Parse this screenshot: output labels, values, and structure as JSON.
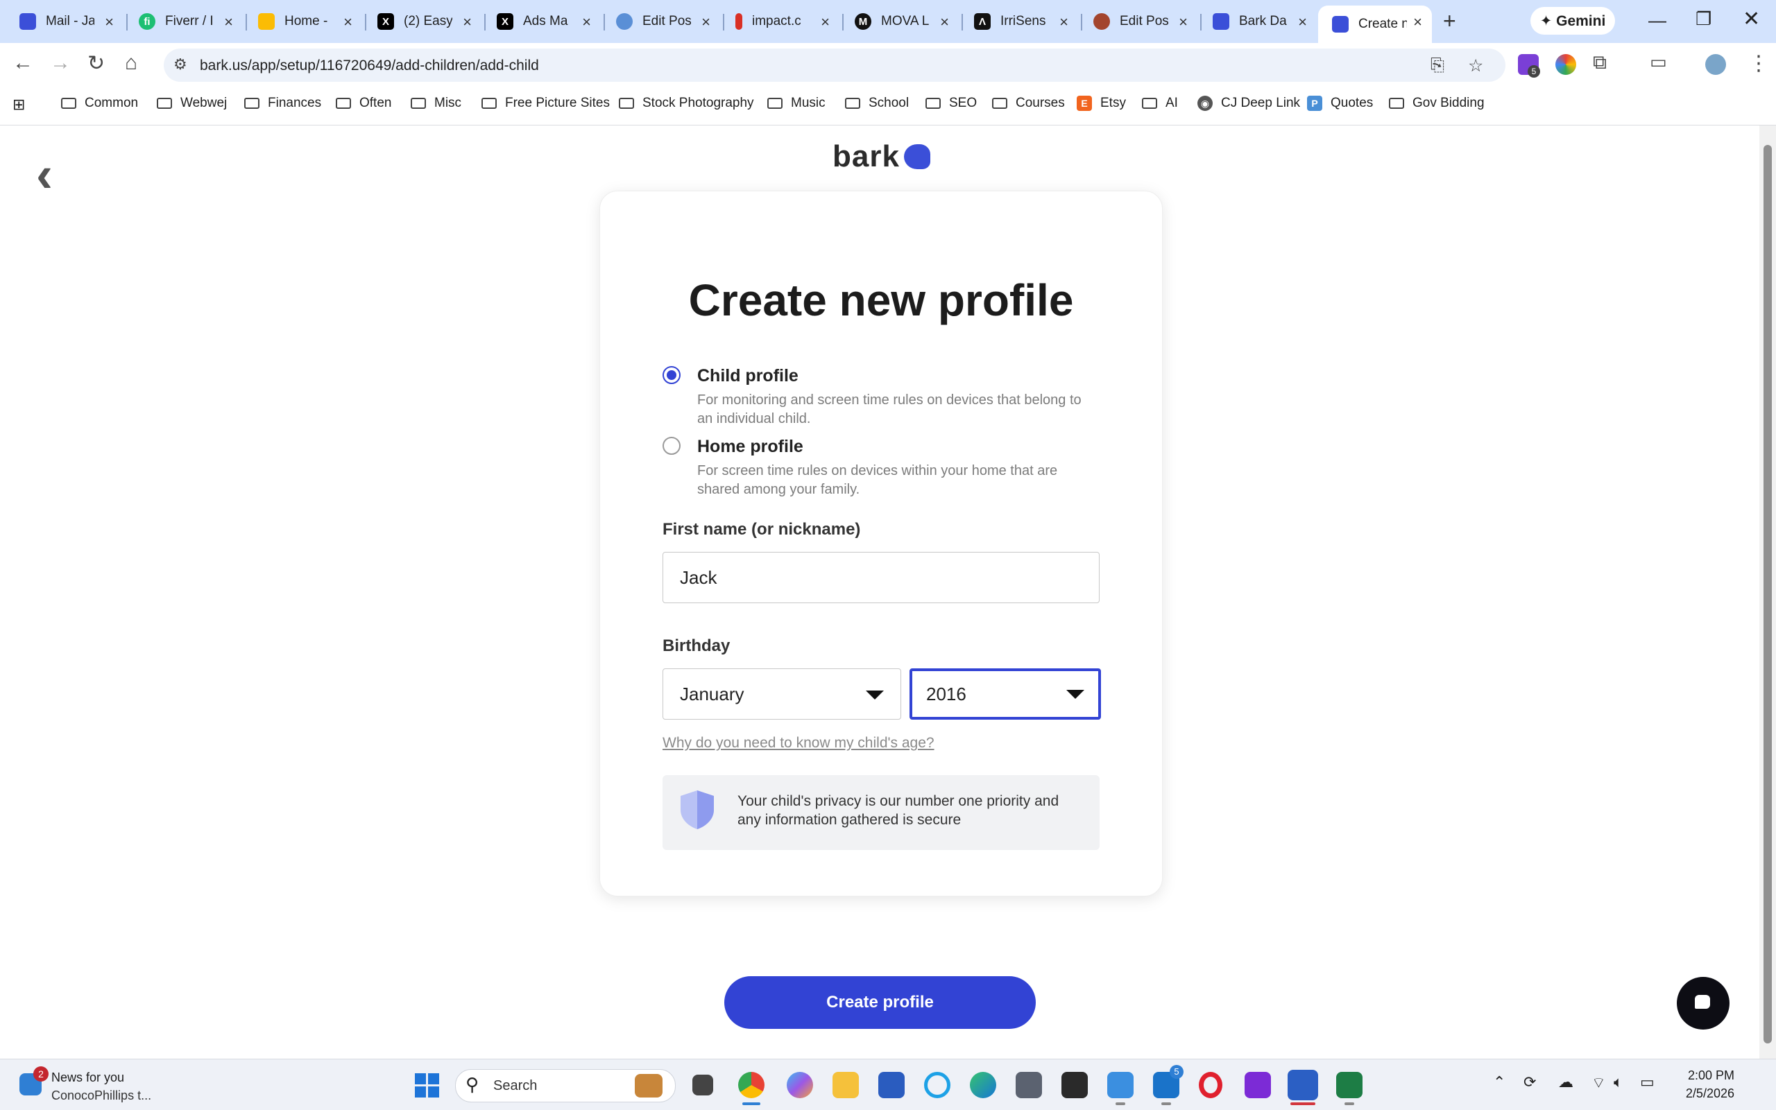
{
  "browser": {
    "tabs": [
      {
        "label": "Mail - Ja",
        "favicon_color": "#3b4fd8",
        "favicon_text": ""
      },
      {
        "label": "Fiverr / I",
        "favicon_color": "#1dbf73",
        "favicon_text": "fi"
      },
      {
        "label": "Home -",
        "favicon_color": "#fbbc04",
        "favicon_text": ""
      },
      {
        "label": "(2) Easy",
        "favicon_color": "#000000",
        "favicon_text": "X"
      },
      {
        "label": "Ads Ma",
        "favicon_color": "#000000",
        "favicon_text": "X"
      },
      {
        "label": "Edit Pos",
        "favicon_color": "#5a8fd6",
        "favicon_text": ""
      },
      {
        "label": "impact.c",
        "favicon_color": "#d93025",
        "favicon_text": ""
      },
      {
        "label": "MOVA L",
        "favicon_color": "#111111",
        "favicon_text": "M"
      },
      {
        "label": "IrriSens",
        "favicon_color": "#111111",
        "favicon_text": "Λ"
      },
      {
        "label": "Edit Pos",
        "favicon_color": "#a3452e",
        "favicon_text": ""
      },
      {
        "label": "Bark Da",
        "favicon_color": "#3b4fd8",
        "favicon_text": ""
      },
      {
        "label": "Create n",
        "favicon_color": "#3b4fd8",
        "favicon_text": "",
        "active": true
      }
    ],
    "new_tab": "+",
    "gemini_label": "✦ Gemini",
    "url": "bark.us/app/setup/116720649/add-children/add-child",
    "extension_badge": "5",
    "bookmarks": [
      {
        "label": "Common",
        "type": "folder"
      },
      {
        "label": "Webwej",
        "type": "folder"
      },
      {
        "label": "Finances",
        "type": "folder"
      },
      {
        "label": "Often",
        "type": "folder"
      },
      {
        "label": "Misc",
        "type": "folder"
      },
      {
        "label": "Free Picture Sites",
        "type": "folder"
      },
      {
        "label": "Stock Photography",
        "type": "folder"
      },
      {
        "label": "Music",
        "type": "folder"
      },
      {
        "label": "School",
        "type": "folder"
      },
      {
        "label": "SEO",
        "type": "folder"
      },
      {
        "label": "Courses",
        "type": "folder"
      },
      {
        "label": "Etsy",
        "type": "site",
        "color": "#f1641e",
        "text": "E"
      },
      {
        "label": "AI",
        "type": "folder"
      },
      {
        "label": "CJ Deep Link",
        "type": "site",
        "color": "#555555",
        "text": "◉"
      },
      {
        "label": "Quotes",
        "type": "site",
        "color": "#4a8fd6",
        "text": "P"
      },
      {
        "label": "Gov Bidding",
        "type": "folder"
      }
    ]
  },
  "page": {
    "logo": "bark",
    "title": "Create new profile",
    "profile_options": [
      {
        "title": "Child profile",
        "description": "For monitoring and screen time rules on devices that belong to an individual child.",
        "selected": true
      },
      {
        "title": "Home profile",
        "description": "For screen time rules on devices within your home that are shared among your family.",
        "selected": false
      }
    ],
    "name_label": "First name (or nickname)",
    "name_value": "Jack",
    "birthday_label": "Birthday",
    "birth_month": "January",
    "birth_year": "2016",
    "why_age_link": "Why do you need to know my child's age?",
    "privacy_note": "Your child's privacy is our number one priority and any information gathered is secure",
    "create_button": "Create profile",
    "accent_color": "#3243d4"
  },
  "taskbar": {
    "news_badge": "2",
    "news_title": "News for you",
    "news_subtitle": "ConocoPhillips t...",
    "search_label": "Search",
    "outlook_badge": "5",
    "time": "2:00 PM",
    "date": "2/5/2026"
  }
}
